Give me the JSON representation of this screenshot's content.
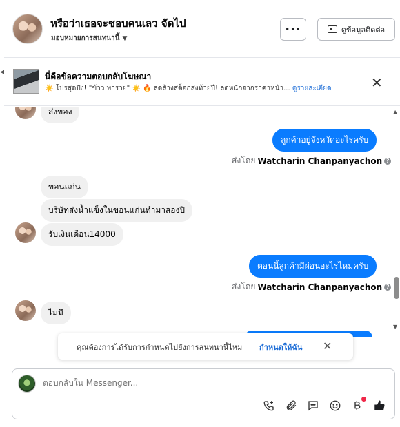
{
  "header": {
    "title": "หรือว่าเธอจะชอบคนเลว จัดไป",
    "subtitle": "มอบหมายการสนทนานี้",
    "more_label": "···",
    "contact_label": "ดูข้อมูลติดต่อ"
  },
  "ad": {
    "title": "นี่คือข้อความตอบกลับโฆษณา",
    "text": "☀️ โปรสุดปัง! \"ข้าว พาราย\" ☀️ 🔥 ลดล้างสต็อกส่งท้ายปี! ลดหนักจากราคาหน้า...",
    "link": "ดูรายละเอียด"
  },
  "messages": {
    "top_partial": "ส่งของ",
    "out1": "ลูกค้าอยู่จังหวัดอะไรครับ",
    "sent_prefix": "ส่งโดย",
    "sender": "Watcharin Chanpanyachon",
    "in1": "ขอนแก่น",
    "in2": "บริษัทส่งน้ำแข็งในขอนแก่นทำมาสองปี",
    "in3": "รับเงินเดือน14000",
    "out2": "ตอนนี้ลูกค้ามีผ่อนอะไรไหมครับ",
    "in4": "ไม่มี"
  },
  "toast": {
    "text": "คุณต้องการได้รับการกำหนดไปยังการสนทนานี้ไหม",
    "link": "กำหนดให้ฉัน"
  },
  "composer": {
    "placeholder": "ตอบกลับใน Messenger..."
  },
  "colors": {
    "outgoing_bubble": "#0a7cff",
    "incoming_bubble": "#f0f0f0",
    "link": "#1a6bd6"
  }
}
